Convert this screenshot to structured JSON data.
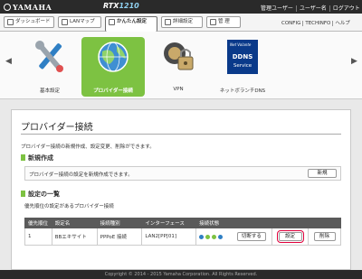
{
  "header": {
    "brand": "YAMAHA",
    "model_prefix": "RTX",
    "model_number": "1210",
    "user_links": [
      "管理ユーザー",
      "ユーザー名",
      "ログアウト"
    ]
  },
  "nav": {
    "tabs": [
      {
        "label": "ダッシュボード",
        "icon": "dashboard-icon"
      },
      {
        "label": "LANマップ",
        "icon": "network-map-icon"
      },
      {
        "label": "かんたん設定",
        "icon": "magic-wand-icon",
        "active": true
      },
      {
        "label": "詳細設定",
        "icon": "gear-icon"
      },
      {
        "label": "管 理",
        "icon": "tools-icon"
      }
    ],
    "right_links": [
      "CONFIG",
      "TECHINFO",
      "ヘルプ"
    ]
  },
  "carousel": {
    "items": [
      {
        "label": "基本設定",
        "icon": "wrench-screwdriver-icon"
      },
      {
        "label": "プロバイダー接続",
        "icon": "globe-icon",
        "selected": true
      },
      {
        "label": "VPN",
        "icon": "vpn-lock-icon"
      },
      {
        "label": "ネットボランチDNS",
        "icon": "ddns-service-icon",
        "icon_text_1": "Net Volante",
        "icon_text_2": "DDNS",
        "icon_text_3": "Service"
      }
    ]
  },
  "main": {
    "title": "プロバイダー接続",
    "description": "プロバイダー接続の新規作成、設定変更、削除ができます。",
    "new_section": {
      "heading": "新規作成",
      "text": "プロバイダー接続の設定を新規作成できます。",
      "button": "新規"
    },
    "list_section": {
      "heading": "設定の一覧",
      "note": "優先順位の設定があるプロバイダー接続",
      "columns": [
        "優先順位",
        "設定名",
        "接続種別",
        "インターフェース",
        "接続状態",
        "",
        ""
      ],
      "rows": [
        {
          "priority": "1",
          "name": "BBエキサイト",
          "type": "PPPoE 接続",
          "interface": "LAN2[PP[01]",
          "disconnect_button": "切断する",
          "settings_button": "設定",
          "delete_button": "削除"
        }
      ]
    }
  },
  "colors": {
    "accent_green": "#7dc242",
    "highlight_red": "#e0003c",
    "dark_bar": "#2a2a2a"
  },
  "footer": {
    "copyright": "Copyright © 2014 - 2015 Yamaha Corporation. All Rights Reserved."
  }
}
